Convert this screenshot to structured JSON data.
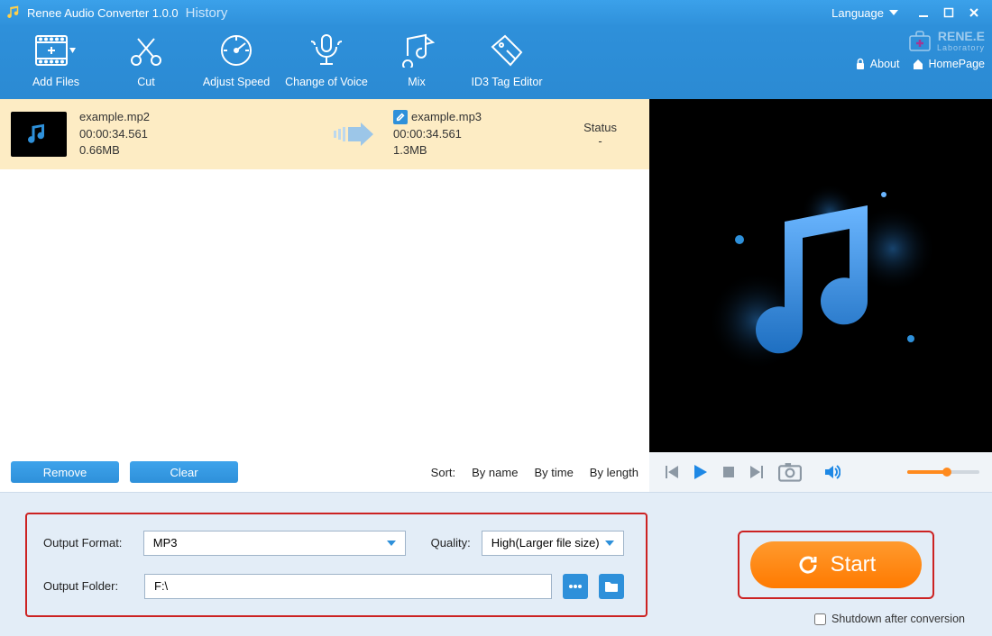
{
  "app": {
    "title": "Renee Audio Converter 1.0.0",
    "history": "History",
    "language": "Language"
  },
  "toolbar": {
    "add_files": "Add Files",
    "cut": "Cut",
    "adjust_speed": "Adjust Speed",
    "change_voice": "Change of Voice",
    "mix": "Mix",
    "id3": "ID3 Tag Editor"
  },
  "brand": {
    "name": "RENE.E",
    "sub": "Laboratory",
    "about": "About",
    "homepage": "HomePage"
  },
  "file": {
    "src_name": "example.mp2",
    "src_dur": "00:00:34.561",
    "src_size": "0.66MB",
    "dst_name": "example.mp3",
    "dst_dur": "00:00:34.561",
    "dst_size": "1.3MB",
    "status_header": "Status",
    "status_value": "-"
  },
  "listbar": {
    "remove": "Remove",
    "clear": "Clear",
    "sort_label": "Sort:",
    "by_name": "By name",
    "by_time": "By time",
    "by_length": "By length"
  },
  "output": {
    "format_label": "Output Format:",
    "format_value": "MP3",
    "quality_label": "Quality:",
    "quality_value": "High(Larger file size)",
    "folder_label": "Output Folder:",
    "folder_value": "F:\\"
  },
  "start": {
    "label": "Start",
    "shutdown": "Shutdown after conversion"
  }
}
